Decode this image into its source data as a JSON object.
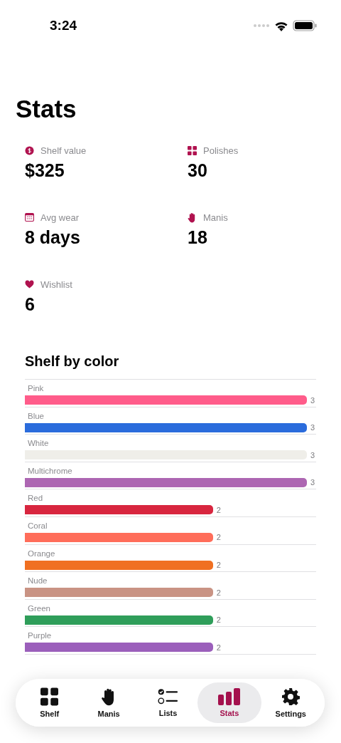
{
  "status_bar": {
    "time": "3:24"
  },
  "title": "Stats",
  "stats": [
    {
      "label": "Shelf value",
      "value": "$325"
    },
    {
      "label": "Polishes",
      "value": "30"
    },
    {
      "label": "Avg wear",
      "value": "8 days"
    },
    {
      "label": "Manis",
      "value": "18"
    },
    {
      "label": "Wishlist",
      "value": "6"
    }
  ],
  "shelf_by_color": {
    "title": "Shelf by color",
    "rows": [
      {
        "label": "Pink",
        "count": "3",
        "level": 1,
        "color": "#ff5c8a"
      },
      {
        "label": "Blue",
        "count": "3",
        "level": 1,
        "color": "#2b6cdc"
      },
      {
        "label": "White",
        "count": "3",
        "level": 1,
        "color": "#efeee9"
      },
      {
        "label": "Multichrome",
        "count": "3",
        "level": 1,
        "color": "#ad66b2"
      },
      {
        "label": "Red",
        "count": "2",
        "level": 0.667,
        "color": "#d8263f"
      },
      {
        "label": "Coral",
        "count": "2",
        "level": 0.667,
        "color": "#ff6d5a"
      },
      {
        "label": "Orange",
        "count": "2",
        "level": 0.667,
        "color": "#f07022"
      },
      {
        "label": "Nude",
        "count": "2",
        "level": 0.667,
        "color": "#c99384"
      },
      {
        "label": "Green",
        "count": "2",
        "level": 0.667,
        "color": "#2f9e5a"
      },
      {
        "label": "Purple",
        "count": "2",
        "level": 0.667,
        "color": "#9b5fbb"
      }
    ]
  },
  "tab_bar": [
    {
      "label": "Shelf",
      "selected": false
    },
    {
      "label": "Manis",
      "selected": false
    },
    {
      "label": "Lists",
      "selected": false
    },
    {
      "label": "Stats",
      "selected": true
    },
    {
      "label": "Settings",
      "selected": false
    }
  ]
}
